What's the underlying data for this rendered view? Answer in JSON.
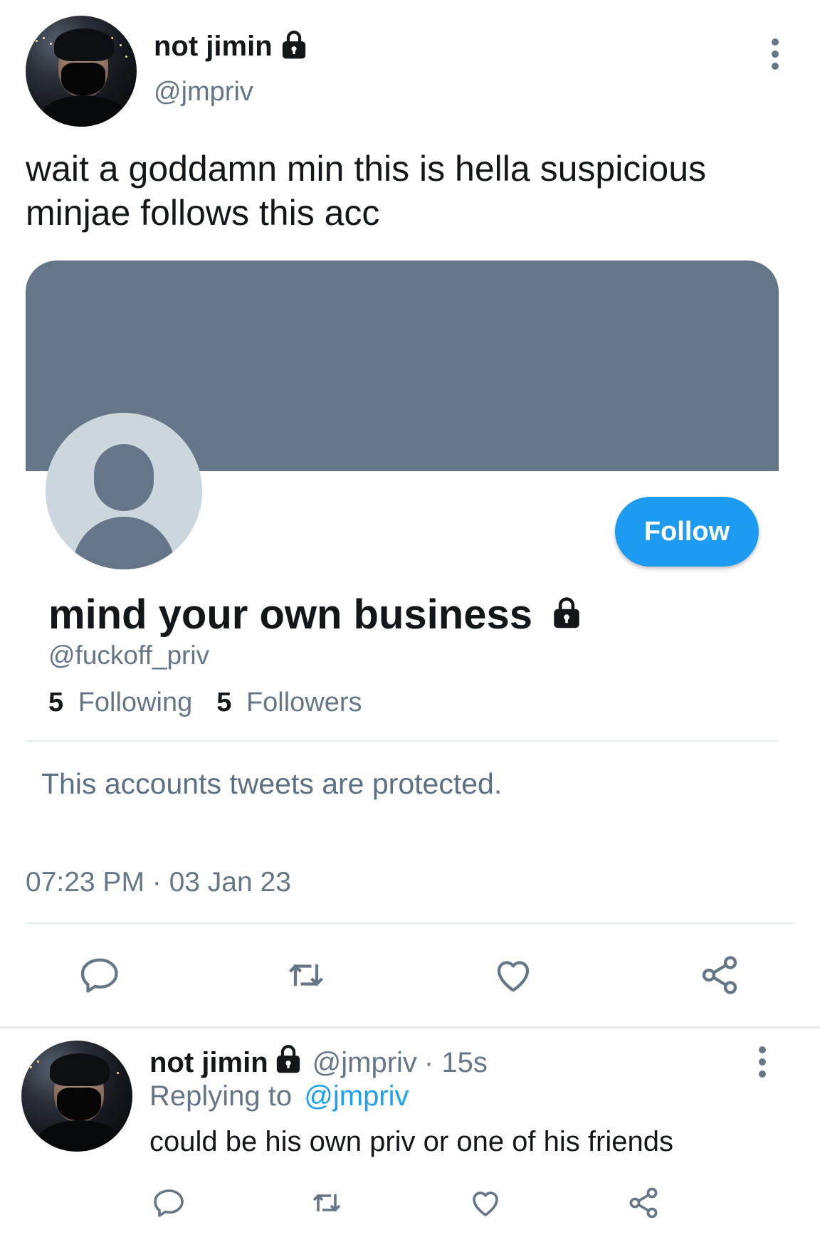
{
  "tweet": {
    "author": {
      "name": "not jimin",
      "handle": "@jmpriv"
    },
    "text_line1": "wait a goddamn min this is hella suspicious",
    "text_line2": "minjae follows this acc",
    "timestamp": "07:23 PM · 03 Jan 23"
  },
  "card": {
    "name": "mind your own business",
    "handle": "@fuckoff_priv",
    "following_count": "5",
    "following_label": "Following",
    "followers_count": "5",
    "followers_label": "Followers",
    "protected_text": "This accounts tweets are protected.",
    "follow_label": "Follow",
    "banner_color": "#647687",
    "follow_color": "#1d9bf0"
  },
  "reply": {
    "author": {
      "name": "not jimin",
      "handle": "@jmpriv"
    },
    "time": "· 15s",
    "replying_prefix": "Replying to",
    "replying_handle": "@jmpriv",
    "text": "could be his own priv or one of his friends"
  },
  "icons": [
    "lock-icon",
    "more-vert-icon",
    "reply-icon",
    "retweet-icon",
    "like-icon",
    "share-icon",
    "default-avatar-icon"
  ]
}
